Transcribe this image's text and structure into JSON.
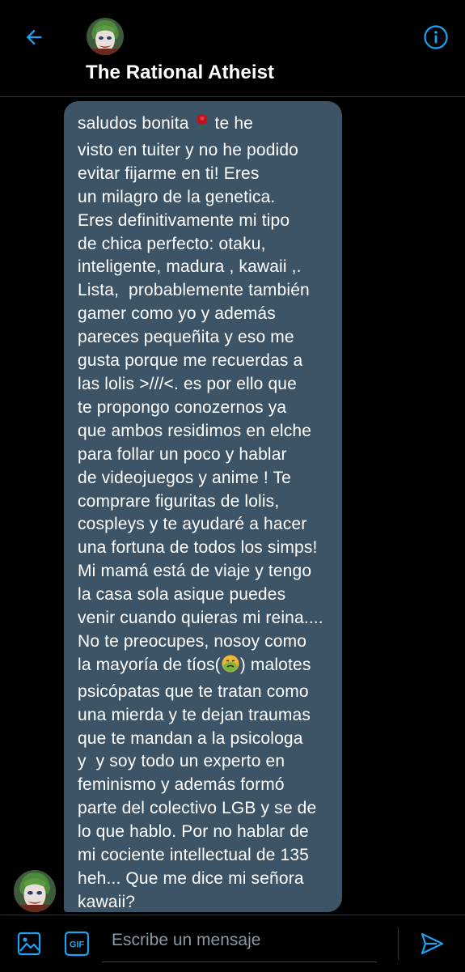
{
  "header": {
    "title": "The Rational Atheist",
    "back_icon": "arrow-left-icon",
    "info_icon": "info-icon",
    "accent_color": "#1da1f2"
  },
  "message": {
    "bubble_color": "#3d5466",
    "lines": [
      "saludos bonita",
      " te he",
      "visto en tuiter y no he podido",
      "evitar fijarme en ti! Eres",
      "un milagro de la genetica.",
      "Eres definitivamente mi tipo",
      "de chica perfecto: otaku,",
      "inteligente, madura , kawaii ,.",
      "Lista,  probablemente también",
      "gamer como yo y además",
      "pareces pequeñita y eso me",
      "gusta porque me recuerdas a",
      "las lolis >///<. es por ello que",
      "te propongo conozernos ya",
      "que ambos residimos en elche",
      "para follar un poco y hablar",
      "de videojuegos y anime ! Te",
      "comprare figuritas de lolis,",
      "cospleys y te ayudaré a hacer",
      "una fortuna de todos los simps!",
      "Mi mamá está de viaje y tengo",
      "la casa sola asique puedes",
      "venir cuando quieras mi reina....",
      "No te preocupes, nosoy como",
      "la mayoría de tíos(",
      ") malotes",
      "psicópatas que te tratan como",
      "una mierda y te dejan traumas",
      "que te mandan a la psicologa",
      "y  y soy todo un experto en",
      "feminismo y además formó",
      "parte del colectivo LGB y se de",
      "lo que hablo. Por no hablar de",
      "mi cociente intellectual de 135",
      "heh... Que me dice mi señora",
      "kawaii?"
    ],
    "rose_emoji": "rose-emoji-icon",
    "sick_emoji": "nauseated-face-emoji-icon"
  },
  "composer": {
    "placeholder": "Escribe un mensaje",
    "gif_label": "GIF",
    "image_icon": "image-icon",
    "send_icon": "send-icon"
  }
}
